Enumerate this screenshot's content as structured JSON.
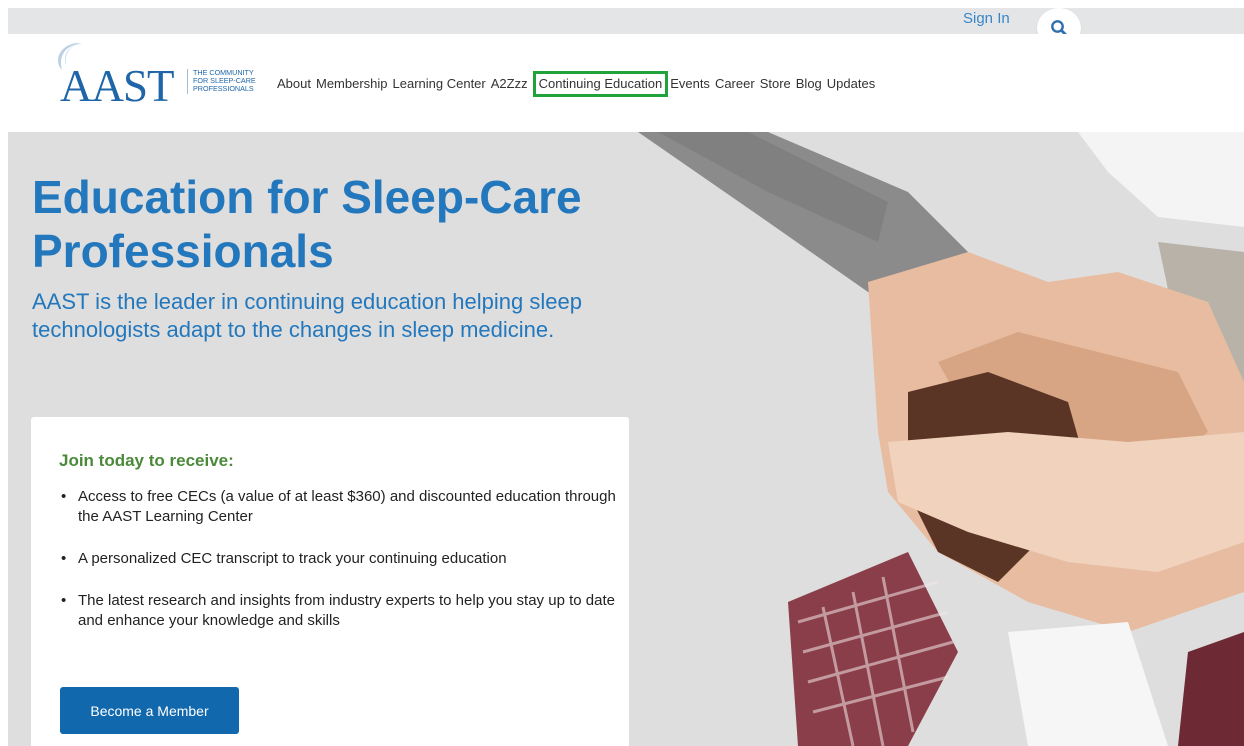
{
  "topbar": {
    "sign_in": "Sign In",
    "search_icon": "search-icon"
  },
  "header": {
    "logo_text": "AAST",
    "logo_tagline": [
      "THE COMMUNITY",
      "FOR SLEEP-CARE",
      "PROFESSIONALS"
    ],
    "nav": [
      {
        "label": "About"
      },
      {
        "label": "Membership"
      },
      {
        "label": "Learning Center"
      },
      {
        "label": "A2Zzz"
      },
      {
        "label": "Continuing Education",
        "highlighted": true
      },
      {
        "label": "Events"
      },
      {
        "label": "Career"
      },
      {
        "label": "Store"
      },
      {
        "label": "Blog"
      },
      {
        "label": "Updates"
      }
    ]
  },
  "hero": {
    "title": "Education for Sleep-Care Professionals",
    "subtitle": "AAST is the leader in continuing education helping sleep technologists adapt to the changes in sleep medicine.",
    "card": {
      "heading": "Join today to receive:",
      "bullets": [
        "Access to free CECs (a value of at least $360) and discounted education through the AAST Learning Center",
        "A personalized CEC transcript to track your continuing education",
        "The latest research and insights from industry experts to help you stay up to date and enhance your knowledge and skills"
      ],
      "cta": "Become a Member"
    }
  },
  "colors": {
    "brand_blue": "#2378bd",
    "logo_blue": "#1f66a9",
    "link_blue": "#3a87c8",
    "heading_green": "#4b8a3a",
    "highlight_green": "#1fa33a",
    "button_blue": "#1168ad"
  }
}
